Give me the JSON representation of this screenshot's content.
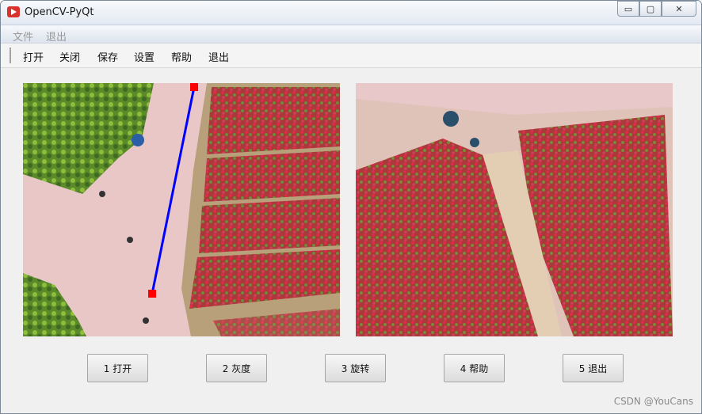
{
  "window": {
    "title": "OpenCV-PyQt",
    "controls": {
      "minimize": "▭",
      "maximize": "▢",
      "close": "✕"
    }
  },
  "menubar": {
    "items": [
      "文件",
      "退出"
    ]
  },
  "toolbar": {
    "items": [
      "打开",
      "关闭",
      "保存",
      "设置",
      "帮助",
      "退出"
    ]
  },
  "buttons": [
    "1 打开",
    "2 灰度",
    "3 旋转",
    "4 帮助",
    "5 退出"
  ],
  "watermark": "CSDN @YouCans",
  "colors": {
    "line": "#0000ff",
    "marker": "#ff0000"
  }
}
